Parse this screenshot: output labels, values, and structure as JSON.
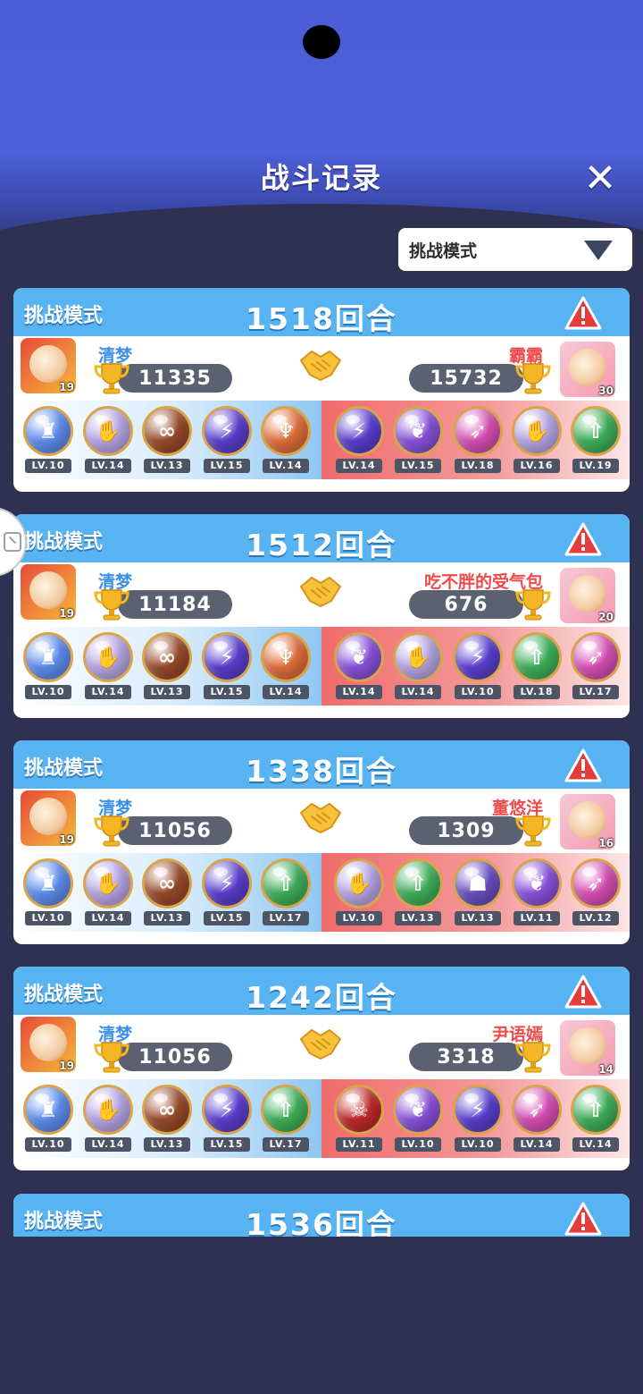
{
  "header": {
    "title": "战斗记录"
  },
  "filter": {
    "selected": "挑战模式"
  },
  "player_name_left": "清梦",
  "records": [
    {
      "mode": "挑战模式",
      "rounds": "1518回合",
      "left": {
        "name": "清梦",
        "score": "11335",
        "level": "19",
        "skills": [
          {
            "lv": "LV.10",
            "color": "#5f8ef0",
            "glyph": "♜"
          },
          {
            "lv": "LV.14",
            "color": "#b9a7e8",
            "glyph": "✋"
          },
          {
            "lv": "LV.13",
            "color": "#9a4a2a",
            "glyph": "∞"
          },
          {
            "lv": "LV.15",
            "color": "#5a3fd0",
            "glyph": "⚡"
          },
          {
            "lv": "LV.14",
            "color": "#e1703a",
            "glyph": "♆"
          }
        ]
      },
      "right": {
        "name": "霸霸",
        "score": "15732",
        "level": "30",
        "skills": [
          {
            "lv": "LV.14",
            "color": "#5a3fd0",
            "glyph": "⚡"
          },
          {
            "lv": "LV.15",
            "color": "#8a52dc",
            "glyph": "❦"
          },
          {
            "lv": "LV.18",
            "color": "#d84fb5",
            "glyph": "➶"
          },
          {
            "lv": "LV.16",
            "color": "#b9a7e8",
            "glyph": "✋"
          },
          {
            "lv": "LV.19",
            "color": "#3fb05a",
            "glyph": "⇧"
          }
        ]
      }
    },
    {
      "mode": "挑战模式",
      "rounds": "1512回合",
      "left": {
        "name": "清梦",
        "score": "11184",
        "level": "19",
        "skills": [
          {
            "lv": "LV.10",
            "color": "#5f8ef0",
            "glyph": "♜"
          },
          {
            "lv": "LV.14",
            "color": "#b9a7e8",
            "glyph": "✋"
          },
          {
            "lv": "LV.13",
            "color": "#9a4a2a",
            "glyph": "∞"
          },
          {
            "lv": "LV.15",
            "color": "#5a3fd0",
            "glyph": "⚡"
          },
          {
            "lv": "LV.14",
            "color": "#e1703a",
            "glyph": "♆"
          }
        ]
      },
      "right": {
        "name": "吃不胖的受气包",
        "score": "676",
        "level": "20",
        "skills": [
          {
            "lv": "LV.14",
            "color": "#8a52dc",
            "glyph": "❦"
          },
          {
            "lv": "LV.14",
            "color": "#b9a7e8",
            "glyph": "✋"
          },
          {
            "lv": "LV.10",
            "color": "#5a3fd0",
            "glyph": "⚡"
          },
          {
            "lv": "LV.18",
            "color": "#3fb05a",
            "glyph": "⇧"
          },
          {
            "lv": "LV.17",
            "color": "#d84fb5",
            "glyph": "➶"
          }
        ]
      }
    },
    {
      "mode": "挑战模式",
      "rounds": "1338回合",
      "left": {
        "name": "清梦",
        "score": "11056",
        "level": "19",
        "skills": [
          {
            "lv": "LV.10",
            "color": "#5f8ef0",
            "glyph": "♜"
          },
          {
            "lv": "LV.14",
            "color": "#b9a7e8",
            "glyph": "✋"
          },
          {
            "lv": "LV.13",
            "color": "#9a4a2a",
            "glyph": "∞"
          },
          {
            "lv": "LV.15",
            "color": "#5a3fd0",
            "glyph": "⚡"
          },
          {
            "lv": "LV.17",
            "color": "#3fb05a",
            "glyph": "⇧"
          }
        ]
      },
      "right": {
        "name": "董悠洋",
        "score": "1309",
        "level": "16",
        "skills": [
          {
            "lv": "LV.10",
            "color": "#b9a7e8",
            "glyph": "✋"
          },
          {
            "lv": "LV.13",
            "color": "#3fb05a",
            "glyph": "⇧"
          },
          {
            "lv": "LV.13",
            "color": "#6a4fc4",
            "glyph": "☗"
          },
          {
            "lv": "LV.11",
            "color": "#8a52dc",
            "glyph": "❦"
          },
          {
            "lv": "LV.12",
            "color": "#d84fb5",
            "glyph": "➶"
          }
        ]
      }
    },
    {
      "mode": "挑战模式",
      "rounds": "1242回合",
      "left": {
        "name": "清梦",
        "score": "11056",
        "level": "19",
        "skills": [
          {
            "lv": "LV.10",
            "color": "#5f8ef0",
            "glyph": "♜"
          },
          {
            "lv": "LV.14",
            "color": "#b9a7e8",
            "glyph": "✋"
          },
          {
            "lv": "LV.13",
            "color": "#9a4a2a",
            "glyph": "∞"
          },
          {
            "lv": "LV.15",
            "color": "#5a3fd0",
            "glyph": "⚡"
          },
          {
            "lv": "LV.17",
            "color": "#3fb05a",
            "glyph": "⇧"
          }
        ]
      },
      "right": {
        "name": "尹语嫣",
        "score": "3318",
        "level": "14",
        "skills": [
          {
            "lv": "LV.11",
            "color": "#c02a2a",
            "glyph": "☠"
          },
          {
            "lv": "LV.10",
            "color": "#8a52dc",
            "glyph": "❦"
          },
          {
            "lv": "LV.10",
            "color": "#5a3fd0",
            "glyph": "⚡"
          },
          {
            "lv": "LV.14",
            "color": "#d84fb5",
            "glyph": "➶"
          },
          {
            "lv": "LV.14",
            "color": "#3fb05a",
            "glyph": "⇧"
          }
        ]
      }
    }
  ],
  "partial_record": {
    "mode": "挑战模式",
    "rounds": "1536回合"
  },
  "colors": {
    "header_blue": "#57b3f2",
    "left_name": "#3b8fe6",
    "right_name": "#ef4b4b"
  }
}
